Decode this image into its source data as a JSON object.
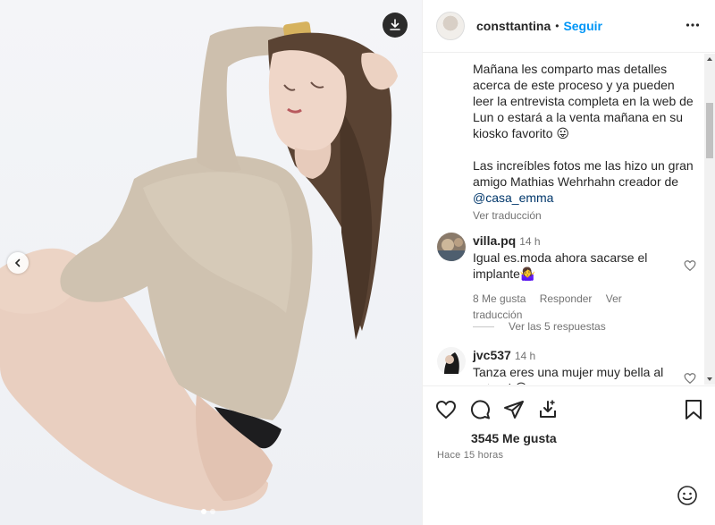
{
  "post": {
    "username": "consttantina",
    "separator": "•",
    "follow_label": "Seguir",
    "more_icon": "more-horizontal-icon",
    "download_icon": "download-icon",
    "prev_icon": "chevron-left-icon"
  },
  "caption": {
    "paragraph_1": "Mañana les comparto mas detalles acerca de este proceso y ya pueden leer la entrevista completa en la web de Lun o estará a la venta mañana en su kiosko favorito 😛",
    "paragraph_2_text": "Las increíbles fotos me las hizo un gran amigo Mathias Wehrhahn creador de ",
    "paragraph_2_mention": "@casa_emma",
    "translate_label": "Ver traducción"
  },
  "comments": [
    {
      "user": "villa.pq",
      "time": "14 h",
      "text": "Igual es.moda ahora sacarse el implante🤷‍♀️",
      "likes_label": "8 Me gusta",
      "reply_label": "Responder",
      "translate_label": "Ver traducción"
    },
    {
      "user": "jvc537",
      "time": "14 h",
      "text": "Tanza eres una mujer muy bella al natural 😊"
    }
  ],
  "replies_label": "Ver las 5 respuestas",
  "likes_count": "3545 Me gusta",
  "time_ago": "Hace 15 horas",
  "colors": {
    "accent": "#0095f6",
    "text": "#262626",
    "secondary": "#737373",
    "mention": "#00376b"
  },
  "carousel": {
    "total": 2,
    "active": 1
  }
}
